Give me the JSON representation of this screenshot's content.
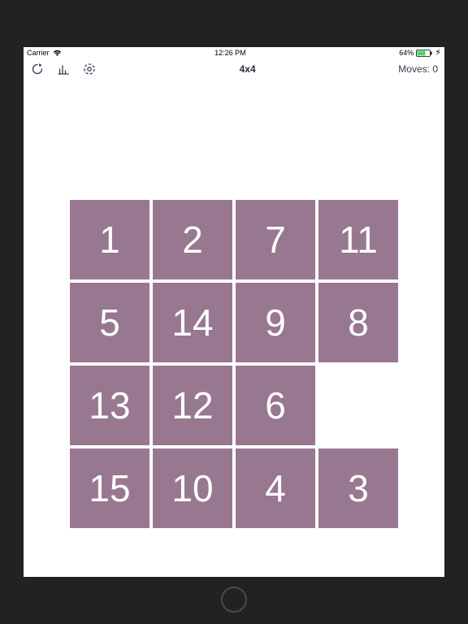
{
  "status": {
    "carrier": "Carrier",
    "time": "12:26 PM",
    "battery": "64%"
  },
  "nav": {
    "title": "4x4",
    "moves_label": "Moves:",
    "moves_value": "0"
  },
  "board": {
    "tiles": [
      {
        "value": "1",
        "empty": false
      },
      {
        "value": "2",
        "empty": false
      },
      {
        "value": "7",
        "empty": false
      },
      {
        "value": "11",
        "empty": false
      },
      {
        "value": "5",
        "empty": false
      },
      {
        "value": "14",
        "empty": false
      },
      {
        "value": "9",
        "empty": false
      },
      {
        "value": "8",
        "empty": false
      },
      {
        "value": "13",
        "empty": false
      },
      {
        "value": "12",
        "empty": false
      },
      {
        "value": "6",
        "empty": false
      },
      {
        "value": "",
        "empty": true
      },
      {
        "value": "15",
        "empty": false
      },
      {
        "value": "10",
        "empty": false
      },
      {
        "value": "4",
        "empty": false
      },
      {
        "value": "3",
        "empty": false
      }
    ]
  },
  "colors": {
    "tile": "#987790",
    "navText": "#3b3b56"
  }
}
